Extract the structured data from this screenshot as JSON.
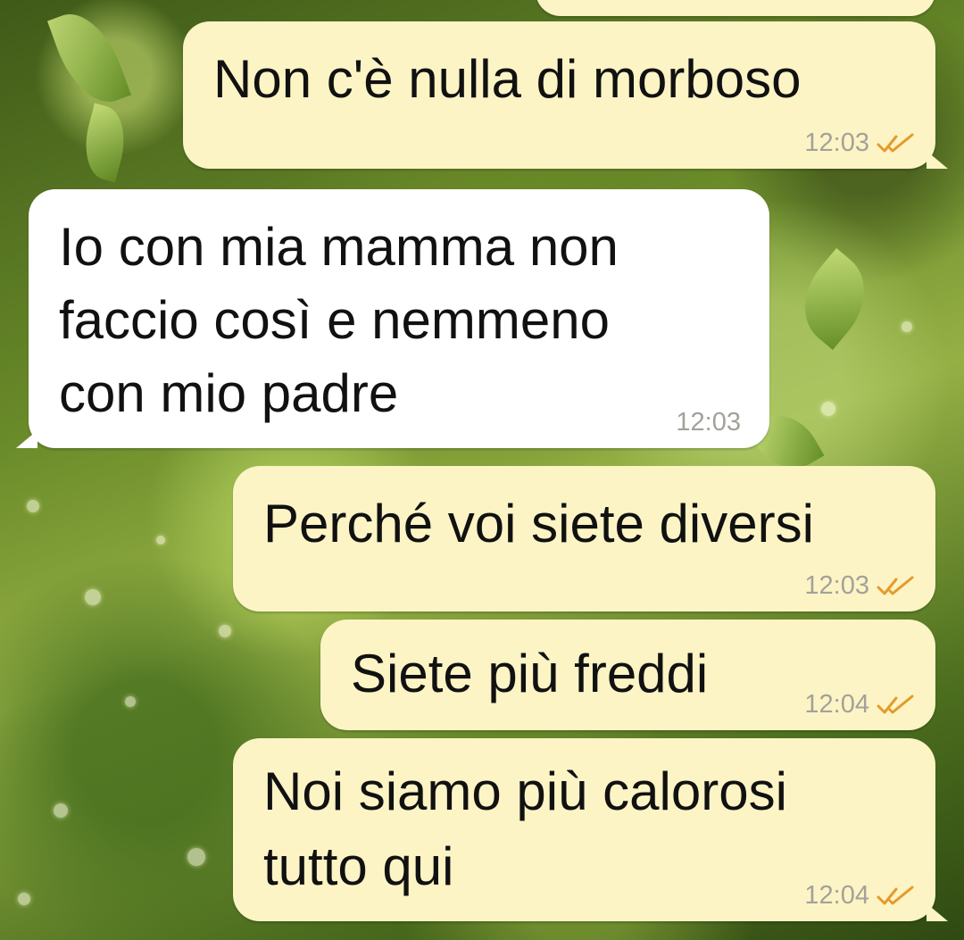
{
  "colors": {
    "outgoing_bubble": "#fcf4c5",
    "incoming_bubble": "#ffffff",
    "timestamp": "#a4a19a",
    "read_ticks": "#e59a2c"
  },
  "messages": [
    {
      "direction": "outgoing",
      "text": "",
      "time": "",
      "status_icon": "double-check-icon"
    },
    {
      "direction": "outgoing",
      "text": "Non c'è nulla di morboso",
      "time": "12:03",
      "status_icon": "double-check-icon"
    },
    {
      "direction": "incoming",
      "text": "Io con mia mamma non\nfaccio così e nemmeno\ncon mio padre",
      "time": "12:03"
    },
    {
      "direction": "outgoing",
      "text": "Perché voi siete diversi",
      "time": "12:03",
      "status_icon": "double-check-icon"
    },
    {
      "direction": "outgoing",
      "text": "Siete più freddi",
      "time": "12:04",
      "status_icon": "double-check-icon"
    },
    {
      "direction": "outgoing",
      "text": "Noi siamo più calorosi\ntutto qui",
      "time": "12:04",
      "status_icon": "double-check-icon"
    }
  ]
}
